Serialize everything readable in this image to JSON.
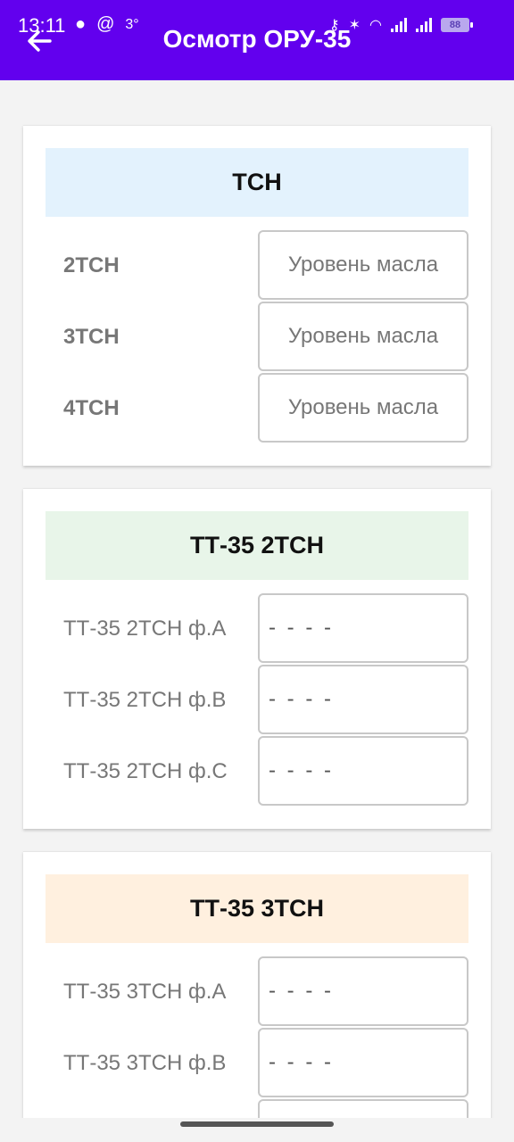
{
  "status_bar": {
    "time": "13:11",
    "temperature": "3°",
    "battery": "88"
  },
  "app_bar": {
    "title": "Осмотр ОРУ-35"
  },
  "sections": [
    {
      "title": "ТСН",
      "header_color": "#e3f2fd",
      "rows": [
        {
          "label": "2ТСН",
          "hint": "Уровень масла"
        },
        {
          "label": "3ТСН",
          "hint": "Уровень масла"
        },
        {
          "label": "4ТСН",
          "hint": "Уровень масла"
        }
      ]
    },
    {
      "title": "ТТ-35 2ТСН",
      "header_color": "#e8f5e9",
      "rows": [
        {
          "label": "ТТ-35 2ТСН ф.А",
          "value": "- - - -"
        },
        {
          "label": "ТТ-35 2ТСН ф.В",
          "value": "- - - -"
        },
        {
          "label": "ТТ-35 2ТСН ф.С",
          "value": "- - - -"
        }
      ]
    },
    {
      "title": "ТТ-35 3ТСН",
      "header_color": "#fff0df",
      "rows": [
        {
          "label": "ТТ-35 3ТСН ф.А",
          "value": "- - - -"
        },
        {
          "label": "ТТ-35 3ТСН ф.В",
          "value": "- - - -"
        },
        {
          "label": "",
          "value": ""
        }
      ]
    }
  ],
  "colors": {
    "app_bar": "#6200ee",
    "background": "#f3f3f3"
  }
}
